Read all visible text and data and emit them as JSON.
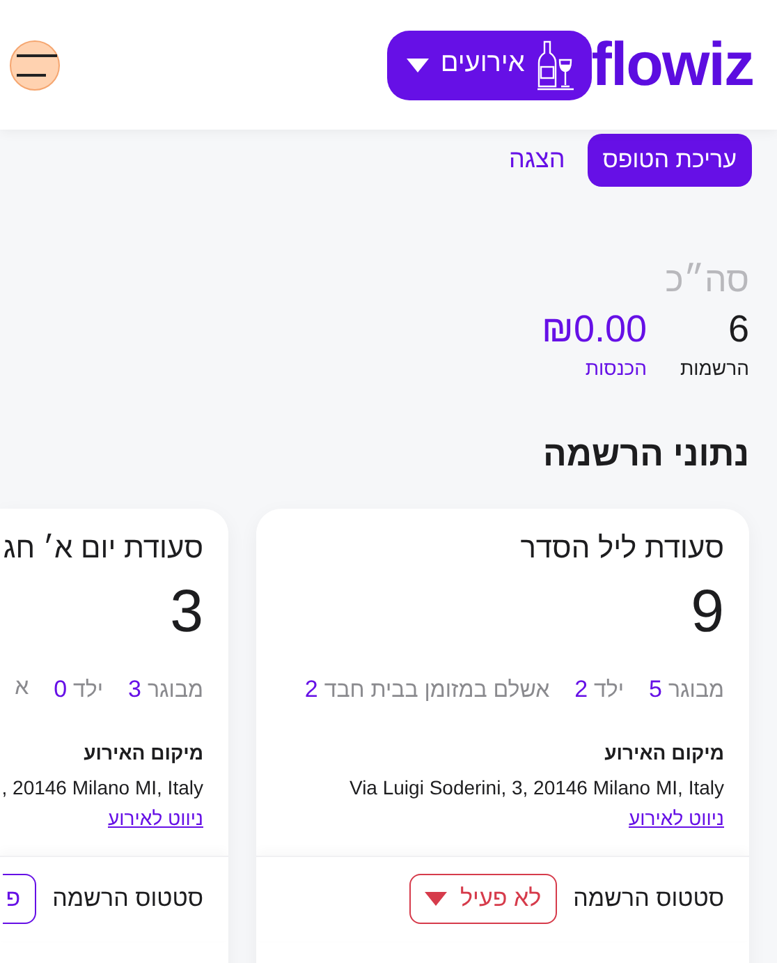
{
  "header": {
    "logo": "flowiz",
    "events_button": {
      "label": "אירועים"
    }
  },
  "tabs": [
    {
      "label": "עריכת הטופס",
      "selected": true
    },
    {
      "label": "הצגה",
      "selected": false
    }
  ],
  "totals": {
    "title": "סה״כ",
    "stats": [
      {
        "value": "6",
        "label": "הרשמות",
        "kind": "count"
      },
      {
        "value": "₪0.00",
        "label": "הכנסות",
        "kind": "money"
      }
    ]
  },
  "section_title": "נתוני הרשמה",
  "cards": [
    {
      "title": "סעודת ליל הסדר",
      "total": "9",
      "counts": [
        {
          "label": "מבוגר",
          "value": "5"
        },
        {
          "label": "ילד",
          "value": "2"
        },
        {
          "label": "אשלם במזומן בבית חבד",
          "value": "2"
        }
      ],
      "location_label": "מיקום האירוע",
      "address": "Via Luigi Soderini, 3, 20146 Milano MI, Italy",
      "nav_link": "ניווט לאירוע",
      "status_label": "סטטוס הרשמה",
      "status": {
        "label": "לא פעיל",
        "active": false
      },
      "clipped": false
    },
    {
      "title": "סעודת יום א׳ חג",
      "total": "3",
      "counts": [
        {
          "label": "מבוגר",
          "value": "3"
        },
        {
          "label": "ילד",
          "value": "0"
        },
        {
          "label": "א"
        }
      ],
      "location_label": "מיקום האירוע",
      "address": ", 20146 Milano MI, Italy",
      "nav_link": "ניווט לאירוע",
      "status_label": "סטטוס הרשמה",
      "status": {
        "label": "פ",
        "active": true
      },
      "clipped": true
    }
  ]
}
